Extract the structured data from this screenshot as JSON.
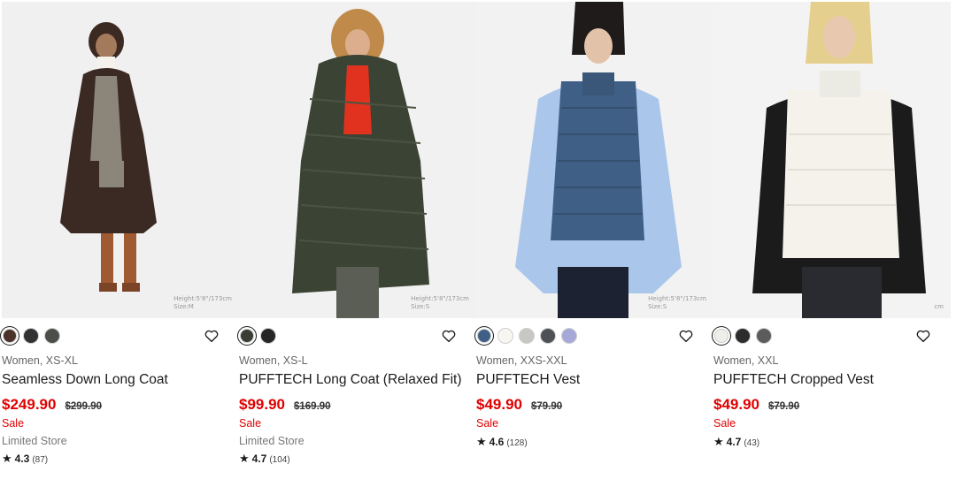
{
  "products": [
    {
      "swatches": [
        "#4a3129",
        "#303233",
        "#4b4e49"
      ],
      "selected_swatch": 0,
      "size_note": [
        "Height:5'8\"/173cm",
        "Size:M"
      ],
      "meta": "Women, XS-XL",
      "name": "Seamless Down Long Coat",
      "price": "$249.90",
      "was_price": "$299.90",
      "sale": "Sale",
      "store": "Limited Store",
      "rating": "4.3",
      "reviews": "(87)"
    },
    {
      "swatches": [
        "#3a3d36",
        "#262626"
      ],
      "selected_swatch": 0,
      "size_note": [
        "Height:5'8\"/173cm",
        "Size:S"
      ],
      "meta": "Women, XS-L",
      "name": "PUFFTECH Long Coat (Relaxed Fit)",
      "price": "$99.90",
      "was_price": "$169.90",
      "sale": "Sale",
      "store": "Limited Store",
      "rating": "4.7",
      "reviews": "(104)"
    },
    {
      "swatches": [
        "#3f5f86",
        "#f7f6f0",
        "#c9c7c3",
        "#4d5055",
        "#a6a9d8"
      ],
      "selected_swatch": 0,
      "size_note": [
        "Height:5'8\"/173cm",
        "Size:S"
      ],
      "meta": "Women, XXS-XXL",
      "name": "PUFFTECH Vest",
      "price": "$49.90",
      "was_price": "$79.90",
      "sale": "Sale",
      "store": "",
      "rating": "4.6",
      "reviews": "(128)"
    },
    {
      "swatches": [
        "#efefe9",
        "#2c2c2c",
        "#5c5c5c"
      ],
      "selected_swatch": 0,
      "size_note": [
        "cm",
        ""
      ],
      "meta": "Women, XXL",
      "name": "PUFFTECH Cropped Vest",
      "price": "$49.90",
      "was_price": "$79.90",
      "sale": "Sale",
      "store": "",
      "rating": "4.7",
      "reviews": "(43)"
    }
  ],
  "icons": {
    "favorite": "heart-outline-icon",
    "rating": "star-icon"
  }
}
